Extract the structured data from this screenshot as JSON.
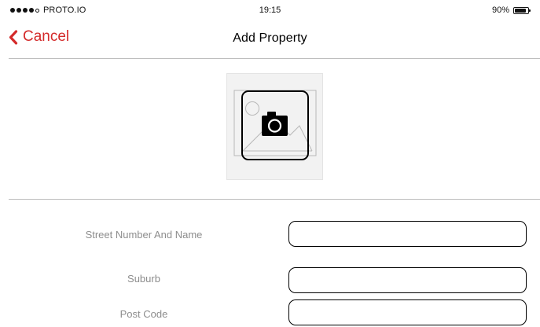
{
  "status_bar": {
    "carrier": "PROTO.IO",
    "time": "19:15",
    "battery": "90%",
    "battery_level": 0.9,
    "signal_bars": 4
  },
  "nav": {
    "back_label": "Cancel",
    "back_icon": "chevron-left-icon",
    "title": "Add Property",
    "accent_color": "#d42a2a"
  },
  "photo_picker": {
    "icon": "camera-icon",
    "placeholder_icon": "image-placeholder-icon"
  },
  "form": {
    "fields": [
      {
        "label": "Street Number And Name",
        "value": "",
        "placeholder": ""
      },
      {
        "label": "Suburb",
        "value": "",
        "placeholder": ""
      },
      {
        "label": "Post Code",
        "value": "",
        "placeholder": ""
      }
    ]
  }
}
